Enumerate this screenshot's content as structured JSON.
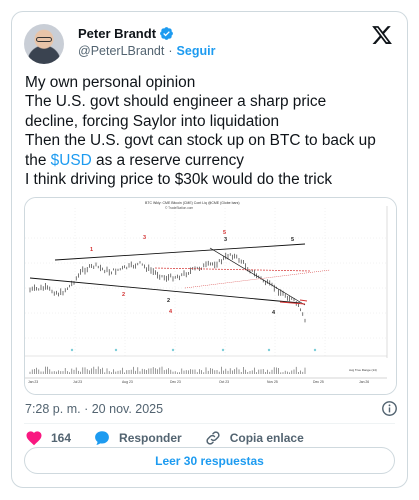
{
  "author": {
    "name": "Peter Brandt",
    "handle": "@PeterLBrandt",
    "separator": "·",
    "follow_label": "Seguir"
  },
  "tweet": {
    "lines": [
      "My own personal opinion",
      "The U.S. govt should engineer a sharp price",
      "decline, forcing Saylor into liquidation",
      "Then the U.S. govt can stock up on BTC to back up"
    ],
    "line5_pre": "the ",
    "cashtag": "$USD",
    "line5_post": " as a reserve currency",
    "line6": "I think driving price to $30k would do the trick"
  },
  "media_chart": {
    "header": "BTC Wkly: CME Bitcoin (CME) Cont Liq @CME (Globe bars)",
    "subheader": "© TradeStation.com",
    "wave_labels": [
      {
        "text": "1",
        "color": "#d32f2f"
      },
      {
        "text": "3",
        "color": "#d32f2f"
      },
      {
        "text": "5",
        "color": "#d32f2f"
      },
      {
        "text": "3",
        "color": "#222222"
      },
      {
        "text": "5",
        "color": "#222222"
      },
      {
        "text": "2",
        "color": "#d32f2f"
      },
      {
        "text": "4",
        "color": "#d32f2f"
      },
      {
        "text": "2",
        "color": "#222222"
      },
      {
        "text": "4",
        "color": "#222222"
      }
    ],
    "x_ticks": [
      "Jan 23",
      "Jul 23",
      "Aug 23",
      "Dec 23",
      "Oct 23",
      "Nov 25",
      "Dec 25",
      "Jan 26"
    ],
    "volume_label": "Avg True Range (14)"
  },
  "meta": {
    "time": "7:28 p. m.",
    "sep": "·",
    "date": "20 nov. 2025"
  },
  "actions": {
    "likes": "164",
    "reply_label": "Responder",
    "copy_label": "Copia enlace"
  },
  "replies_button": "Leer 30 respuestas",
  "colors": {
    "accent": "#1d9bf0",
    "like": "#f91880",
    "text": "#0f1419",
    "muted": "#536471"
  }
}
